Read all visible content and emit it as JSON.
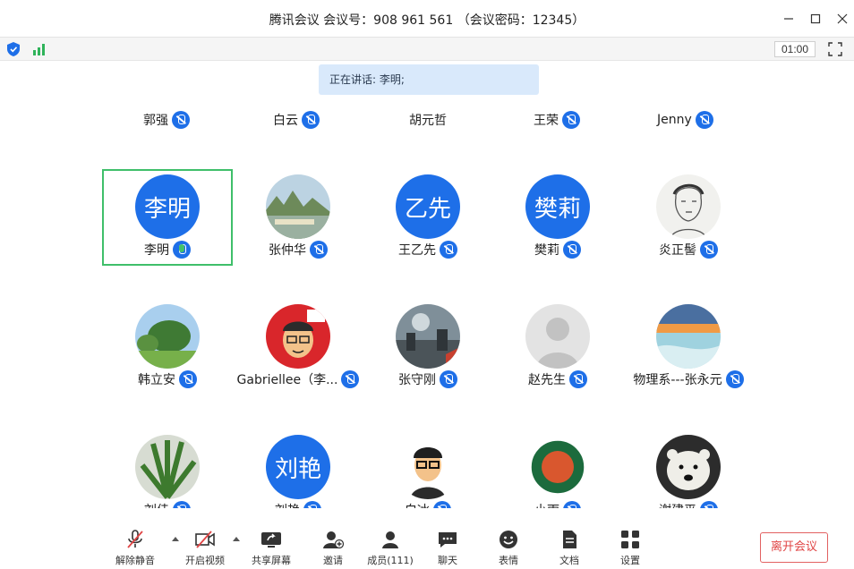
{
  "window": {
    "title": "腾讯会议 会议号：908 961 561 （会议密码：12345）",
    "controls": [
      "minimize-icon",
      "maximize-icon",
      "close-icon"
    ]
  },
  "infobar": {
    "timer": "01:00"
  },
  "speaking": {
    "text": "正在讲话: 李明;"
  },
  "top_row": [
    {
      "name": "郭强"
    },
    {
      "name": "白云"
    },
    {
      "name": "胡元哲"
    },
    {
      "name": "王荣"
    },
    {
      "name": "Jenny"
    }
  ],
  "participants": [
    {
      "name": "李明",
      "avatar_text": "李明",
      "avatar_type": "text",
      "speaking": true
    },
    {
      "name": "张仲华",
      "avatar_type": "landscape-photo"
    },
    {
      "name": "王乙先",
      "avatar_text": "乙先",
      "avatar_type": "text"
    },
    {
      "name": "樊莉",
      "avatar_text": "樊莉",
      "avatar_type": "text"
    },
    {
      "name": "炎正髻",
      "avatar_type": "sketch-portrait"
    },
    {
      "name": "韩立安",
      "avatar_type": "park-photo"
    },
    {
      "name": "Gabriellee（李...",
      "avatar_type": "cartoon-photo"
    },
    {
      "name": "张守刚",
      "avatar_type": "scifi-photo"
    },
    {
      "name": "赵先生",
      "avatar_type": "default-silhouette"
    },
    {
      "name": "物理系---张永元",
      "avatar_type": "sunset-photo"
    },
    {
      "name": "刘佳",
      "avatar_type": "plant-photo"
    },
    {
      "name": "刘艳",
      "avatar_text": "刘艳",
      "avatar_type": "text"
    },
    {
      "name": "白冰",
      "avatar_type": "cartoon-glasses"
    },
    {
      "name": "小雨",
      "avatar_type": "roland-garros-logo"
    },
    {
      "name": "谢建平",
      "avatar_type": "polar-bear-photo"
    }
  ],
  "toolbar": {
    "unmute": "解除静音",
    "video": "开启视频",
    "share": "共享屏幕",
    "invite": "邀请",
    "members": "成员(111)",
    "chat": "聊天",
    "reactions": "表情",
    "docs": "文档",
    "settings": "设置",
    "leave": "离开会议"
  },
  "colors": {
    "accent": "#1e6fe8",
    "active_border": "#3fbf6a",
    "leave_red": "#e04545",
    "speaking_bg": "#d9e9fb"
  }
}
